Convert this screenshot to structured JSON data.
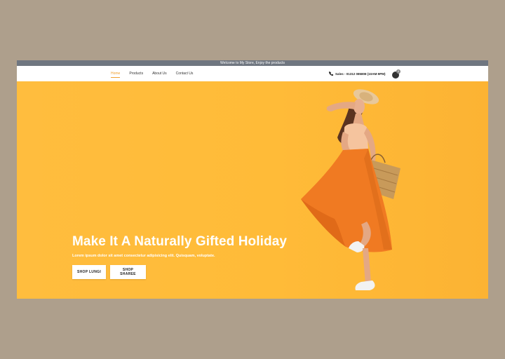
{
  "announcement": "Welcome to My Store, Enjoy the products",
  "nav": {
    "links": [
      "Home",
      "Products",
      "About Us",
      "Contact Us"
    ],
    "active": "Home",
    "sales": "Sales - 01312 085808 (10AM-9PM)",
    "cart_count": "0"
  },
  "hero": {
    "title": "Make It A Naturally Gifted Holiday",
    "subtitle": "Lorem ipsum dolor sit amet consectetur adipisicing elit. Quisquam, voluptate.",
    "buttons": [
      "SHOP LUNGI",
      "SHOP SHAREE"
    ]
  },
  "colors": {
    "hero_bg": "#ffbb38",
    "announce_bg": "#6f7680",
    "accent": "#f0a030",
    "dress": "#f07a22"
  },
  "icons": [
    "phone-icon",
    "cart-icon"
  ]
}
